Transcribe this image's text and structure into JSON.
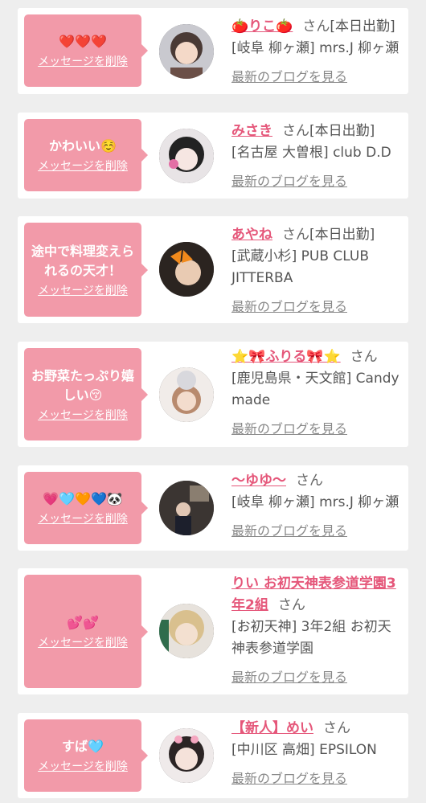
{
  "colors": {
    "accent": "#f29aa9",
    "name": "#e5577a"
  },
  "delete_label": "メッセージを削除",
  "blog_label": "最新のブログを見る",
  "san_label": "さん",
  "cards": [
    {
      "message": "❤️❤️❤️",
      "name": "🍅りこ🍅",
      "status": "[本日出勤]",
      "shop": "[岐阜 柳ヶ瀬] mrs.J 柳ヶ瀬"
    },
    {
      "message": "かわいい☺️",
      "name": "みさき",
      "status": "[本日出勤]",
      "shop": "[名古屋 大曽根] club D.D"
    },
    {
      "message": "途中で料理変えられるの天才！",
      "name": "あやね",
      "status": "[本日出勤]",
      "shop": "[武蔵小杉] PUB CLUB JITTERBA"
    },
    {
      "message": "お野菜たっぷり嬉しい😚",
      "name": "⭐🎀ふりる🎀⭐",
      "status": "",
      "shop": "[鹿児島県・天文館] Candy made"
    },
    {
      "message": "💗🩵🧡💙🐼",
      "name": "〜ゆゆ〜",
      "status": "",
      "shop": "[岐阜 柳ヶ瀬] mrs.J 柳ヶ瀬"
    },
    {
      "message": "💕💕",
      "name": "りい お初天神表参道学園3年2組",
      "status": "",
      "shop": "[お初天神] 3年2組 お初天神表参道学園"
    },
    {
      "message": "すば🩵",
      "name": "【新人】めい",
      "status": "",
      "shop": "[中川区 高畑] EPSILON"
    }
  ]
}
